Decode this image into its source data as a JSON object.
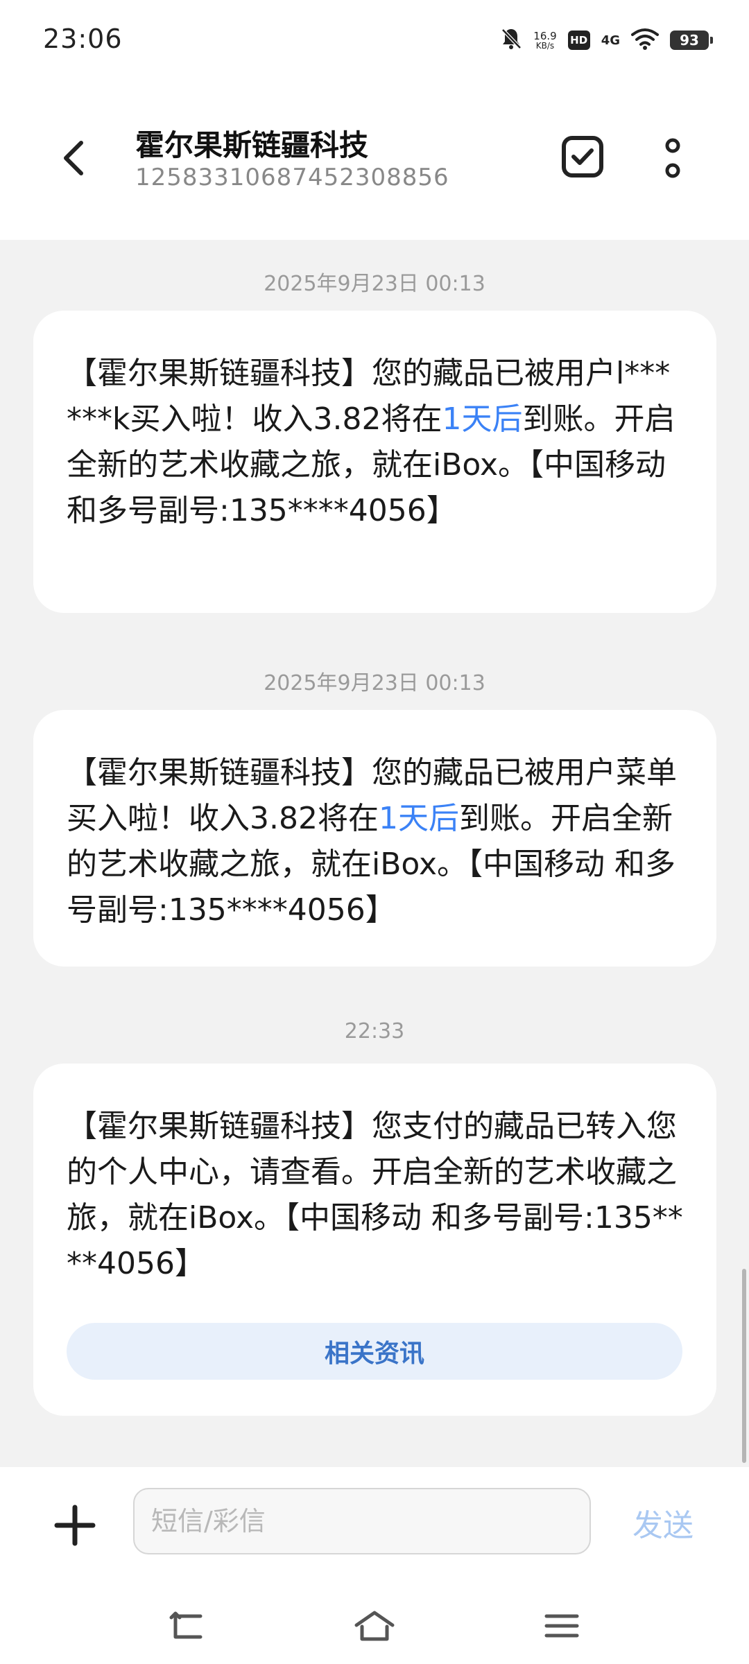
{
  "status_bar": {
    "time": "23:06",
    "speed_value": "16.9",
    "speed_unit": "KB/s",
    "hd_label": "HD",
    "network": "4G",
    "battery": "93",
    "icons": [
      "mute-bell-icon",
      "wifi-icon",
      "battery-icon"
    ]
  },
  "header": {
    "contact_name": "霍尔果斯链疆科技",
    "contact_number": "1258331068745230885​6",
    "icons": [
      "back-arrow-icon",
      "checkbox-select-icon",
      "more-vertical-icon"
    ]
  },
  "messages": [
    {
      "timestamp": "2025年9月23日  00:13",
      "text_before": "【霍尔果斯链疆科技】您的藏品已被用户l******k买入啦！收入3.82将在",
      "link": "1天后",
      "text_after": "到账。开启全新的艺术收藏之旅，就在iBox。【中国移动  和多号副号:135****4056】"
    },
    {
      "timestamp": "2025年9月23日  00:13",
      "text_before": "【霍尔果斯链疆科技】您的藏品已被用户菜单买入啦！收入3.82将在",
      "link": "1天后",
      "text_after": "到账。开启全新的艺术收藏之旅，就在iBox。【中国移动  和多号副号:135****4056】"
    },
    {
      "timestamp": "22:33",
      "text": "【霍尔果斯链疆科技】您支付的藏品已转入您的个人中心，请查看。开启全新的艺术收藏之旅，就在iBox。【中国移动  和多号副号:135****4056】",
      "action_label": "相关资讯"
    }
  ],
  "composer": {
    "placeholder": "短信/彩信",
    "send_label": "发送",
    "icons": [
      "plus-icon"
    ]
  },
  "nav": {
    "icons": [
      "nav-back-icon",
      "nav-home-icon",
      "nav-menu-icon"
    ]
  },
  "colors": {
    "link": "#3b82f6",
    "related_button_bg": "#e8f0fb",
    "related_button_text": "#3a74c8",
    "send_disabled": "#a9c8f2",
    "background": "#f2f2f2"
  }
}
